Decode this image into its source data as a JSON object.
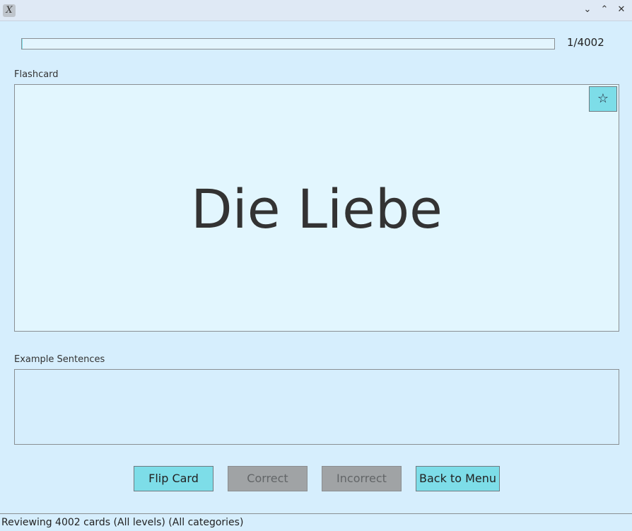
{
  "window": {
    "app_icon": "x-logo-icon",
    "controls": [
      "minimize-icon",
      "maximize-icon",
      "close-icon"
    ]
  },
  "progress": {
    "label": "1/4002",
    "fraction": 0.00025
  },
  "flashcard": {
    "section_label": "Flashcard",
    "word": "Die Liebe",
    "favorite_icon": "star-outline-icon"
  },
  "examples": {
    "section_label": "Example Sentences",
    "text": ""
  },
  "buttons": {
    "flip": "Flip Card",
    "correct": "Correct",
    "incorrect": "Incorrect",
    "back": "Back to Menu"
  },
  "status": {
    "text": "Reviewing 4002 cards (All levels) (All categories)"
  },
  "colors": {
    "background": "#d6eefd",
    "accent_button": "#7ddde8",
    "disabled_button": "#a0a3a5"
  }
}
